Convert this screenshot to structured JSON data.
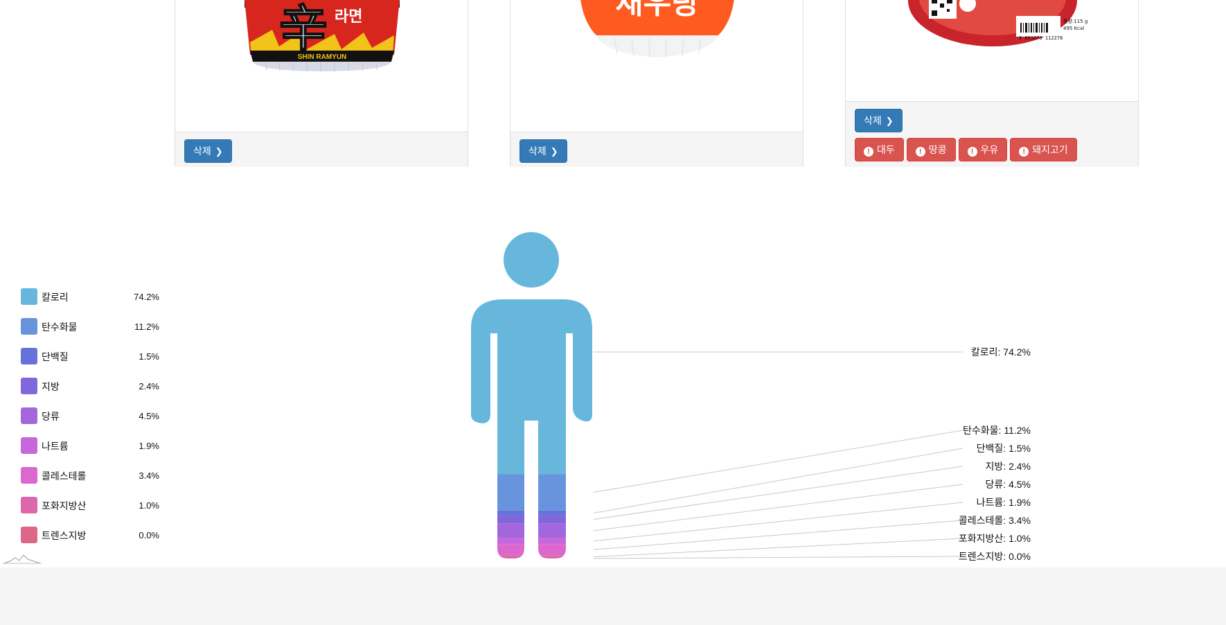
{
  "cards": [
    {
      "product": "shin-ramyun-cup",
      "delete_label": "삭제",
      "allergens": []
    },
    {
      "product": "saeutang-cup",
      "delete_label": "삭제",
      "allergens": []
    },
    {
      "product": "bowl-noodle",
      "delete_label": "삭제",
      "allergens": [
        "대두",
        "땅콩",
        "우유",
        "돼지고기"
      ]
    }
  ],
  "product_texts": {
    "cup1_logo": "辛",
    "cup1_sub": "라면",
    "cup1_brand": "SHIN RAMYUN",
    "cup2_logo": "새우탕",
    "cup3_weight": "중량:115 g",
    "cup3_kcal": "495 Kcal",
    "cup3_barcode": "8 801073 112278"
  },
  "chart_data": {
    "type": "pictorial",
    "categories": [
      "칼로리",
      "탄수화물",
      "단백질",
      "지방",
      "당류",
      "나트륨",
      "콜레스테롤",
      "포화지방산",
      "트렌스지방"
    ],
    "values": [
      74.2,
      11.2,
      1.5,
      2.4,
      4.5,
      1.9,
      3.4,
      1.0,
      0.0
    ],
    "value_labels": [
      "74.2%",
      "11.2%",
      "1.5%",
      "2.4%",
      "4.5%",
      "1.9%",
      "3.4%",
      "1.0%",
      "0.0%"
    ],
    "callouts": [
      "칼로리: 74.2%",
      "탄수화물: 11.2%",
      "단백질: 1.5%",
      "지방: 2.4%",
      "당류: 4.5%",
      "나트륨: 1.9%",
      "콜레스테롤: 3.4%",
      "포화지방산: 1.0%",
      "트렌스지방: 0.0%"
    ],
    "colors": [
      "#67b7dc",
      "#6794dc",
      "#6771dc",
      "#8067dc",
      "#a367dc",
      "#c767dc",
      "#dc67ce",
      "#dc67ab",
      "#dc6788"
    ],
    "legend_position": "left",
    "pictogram": "human-figure"
  }
}
